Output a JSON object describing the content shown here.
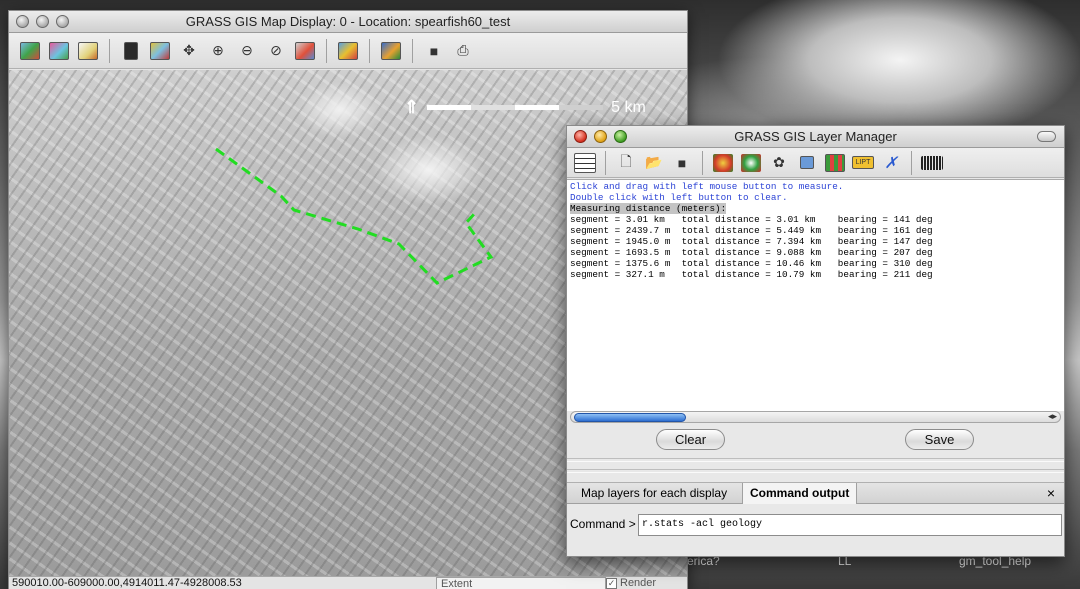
{
  "desktop": {
    "labels": [
      "erica?",
      "LL",
      "gm_tool_help"
    ]
  },
  "map_display": {
    "title": "GRASS GIS Map Display: 0 - Location: spearfish60_test",
    "toolbar_icons": [
      "display-map-icon",
      "redraw-icon",
      "erase-icon",
      "pointer-icon",
      "query-icon",
      "pan-icon",
      "zoom-in-icon",
      "zoom-out-icon",
      "zoom-back-icon",
      "zoom-menu-icon",
      "analyze-icon",
      "overlay-icon",
      "save-icon",
      "print-icon"
    ],
    "scale_label": "5 km",
    "status_coords": "590010.00-609000.00,4914011.47-4928008.53",
    "extent_option": "Extent",
    "render_label": "Render",
    "render_checked": true
  },
  "layer_manager": {
    "title": "GRASS GIS Layer Manager",
    "output_lines": [
      "Click and drag with left mouse button to measure.",
      "Double click with left button to clear.",
      "Measuring distance (meters):",
      "segment = 3.01 km   total distance = 3.01 km    bearing = 141 deg",
      "segment = 2439.7 m  total distance = 5.449 km   bearing = 161 deg",
      "segment = 1945.0 m  total distance = 7.394 km   bearing = 147 deg",
      "segment = 1693.5 m  total distance = 9.088 km   bearing = 207 deg",
      "segment = 1375.6 m  total distance = 10.46 km   bearing = 310 deg",
      "segment = 327.1 m   total distance = 10.79 km   bearing = 211 deg"
    ],
    "clear_label": "Clear",
    "save_label": "Save",
    "tabs": [
      "Map layers for each display",
      "Command output"
    ],
    "close_glyph": "×",
    "command_label": "Command >",
    "command_value": "r.stats -acl geology"
  }
}
